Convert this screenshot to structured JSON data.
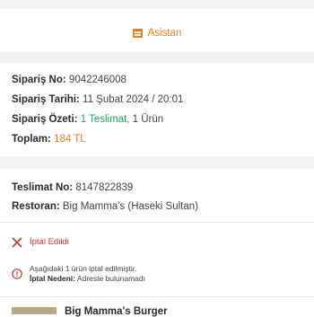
{
  "assistant": {
    "label": "Asistan"
  },
  "order": {
    "number_label": "Sipariş No:",
    "number_value": "9042246008",
    "date_label": "Sipariş Tarihi:",
    "date_value": "11 Şubat 2024 / 20:01",
    "summary_label": "Sipariş Özeti:",
    "summary_deliveries": "1 Teslimat,",
    "summary_items": "1 Ürün",
    "total_label": "Toplam:",
    "total_value": "184 TL"
  },
  "delivery": {
    "number_label": "Teslimat No:",
    "number_value": "8147822839",
    "restaurant_label": "Restoran:",
    "restaurant_value": "Big Mamma's (Haseki Sultan)"
  },
  "status": {
    "text": "İptal Edildi",
    "info_line1": "Aşağıdaki 1 ürün iptal edilmiştir.",
    "reason_label": "İptal Nedeni:",
    "reason_value": "Adreste bulunamadı"
  },
  "product": {
    "name": "Big Mamma's Burger"
  },
  "colors": {
    "accent": "#f27a1a",
    "green": "#22a35a",
    "red": "#d0342c",
    "band": "#f2f2f2"
  }
}
